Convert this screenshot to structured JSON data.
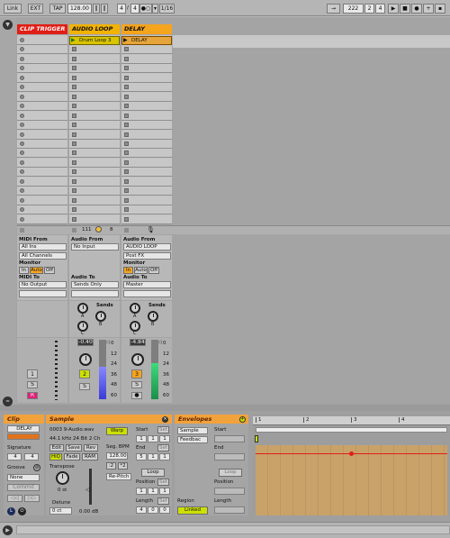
{
  "transport": {
    "link": "Link",
    "ext": "EXT",
    "tap": "TAP",
    "tempo": "128.00",
    "sig_num": "4",
    "sig_den": "4",
    "quant": "1/16",
    "pos_bar": "222",
    "pos_beat": "2",
    "pos_sixteenth": "4"
  },
  "tracks": [
    {
      "name": "CLIP TRIGGER",
      "color": "#e01f16",
      "text_color": "#fff"
    },
    {
      "name": "AUDIO LOOP",
      "color": "#f2b200",
      "text_color": "#000"
    },
    {
      "name": "DELAY",
      "color": "#f5a41d",
      "text_color": "#000"
    }
  ],
  "clips": {
    "audio_loop": "Drum Loop 3",
    "delay": "DELAY"
  },
  "status_bar": {
    "count": "111",
    "count2": "8"
  },
  "io": {
    "midi_from_label": "MIDI From",
    "midi_from_value": "All Ins",
    "midi_channel": "All Channels",
    "monitor_label": "Monitor",
    "in": "In",
    "auto": "Auto",
    "off": "Off",
    "midi_to_label": "MIDI To",
    "midi_to_value": "No Output",
    "audio_from_label": "Audio From",
    "audio_from_value": "No Input",
    "audio_to_label": "Audio To",
    "audio_to_value": "Sends Only",
    "delay_from_value": "AUDIO LOOP",
    "delay_post": "Post FX",
    "delay_to_value": "Master"
  },
  "sends": {
    "label": "Sends",
    "a": "A",
    "b": "B",
    "c": "C"
  },
  "mixer": {
    "vol_audio": "-0.40",
    "vol_delay": "-4.84",
    "db_scale": [
      "0",
      "12",
      "24",
      "36",
      "48",
      "60"
    ],
    "num1": "1",
    "num2": "2",
    "num3": "3",
    "s": "S",
    "r": "R",
    "audio_level": 0.55,
    "delay_level": 0.6
  },
  "clip_panel": {
    "title": "Clip",
    "name": "DELAY",
    "signature_label": "Signature",
    "sig_num": "4",
    "sig_den": "4",
    "groove_label": "Groove",
    "groove_value": "None",
    "commit": "Commit"
  },
  "sample_panel": {
    "title": "Sample",
    "file": "0003 9-Audio.wav",
    "info": "44.1 kHz 24 Bit 2 Ch",
    "edit": "Edit",
    "save": "Save",
    "rev": "Rev",
    "hiq": "HiQ",
    "fade": "Fade",
    "ram": "RAM",
    "transpose_label": "Transpose",
    "transpose_value": "0 st",
    "detune_label": "Detune",
    "detune_value": "0 ct",
    "gain_value": "0.00 dB",
    "warp": "Warp",
    "seg_bpm_label": "Seg. BPM",
    "seg_bpm_value": "128.00",
    "half": ":2",
    "double": "*2",
    "repitch": "Re-Pitch"
  },
  "loop_panel": {
    "start_label": "Start",
    "start": [
      "1",
      "1",
      "1"
    ],
    "end_label": "End",
    "end": [
      "5",
      "1",
      "1"
    ],
    "loop": "Loop",
    "position_label": "Position",
    "position": [
      "1",
      "1",
      "1"
    ],
    "length_label": "Length",
    "length": [
      "4",
      "0",
      "0"
    ]
  },
  "env_panel": {
    "title": "Envelopes",
    "device": "Sample",
    "param": "Feedbac",
    "start_label": "Start",
    "end_label": "End",
    "loop": "Loop",
    "position_label": "Position",
    "length_label": "Length",
    "region_label": "Region",
    "linked": "Linked"
  },
  "ruler": {
    "marks": [
      "1",
      "2",
      "3",
      "4"
    ]
  }
}
